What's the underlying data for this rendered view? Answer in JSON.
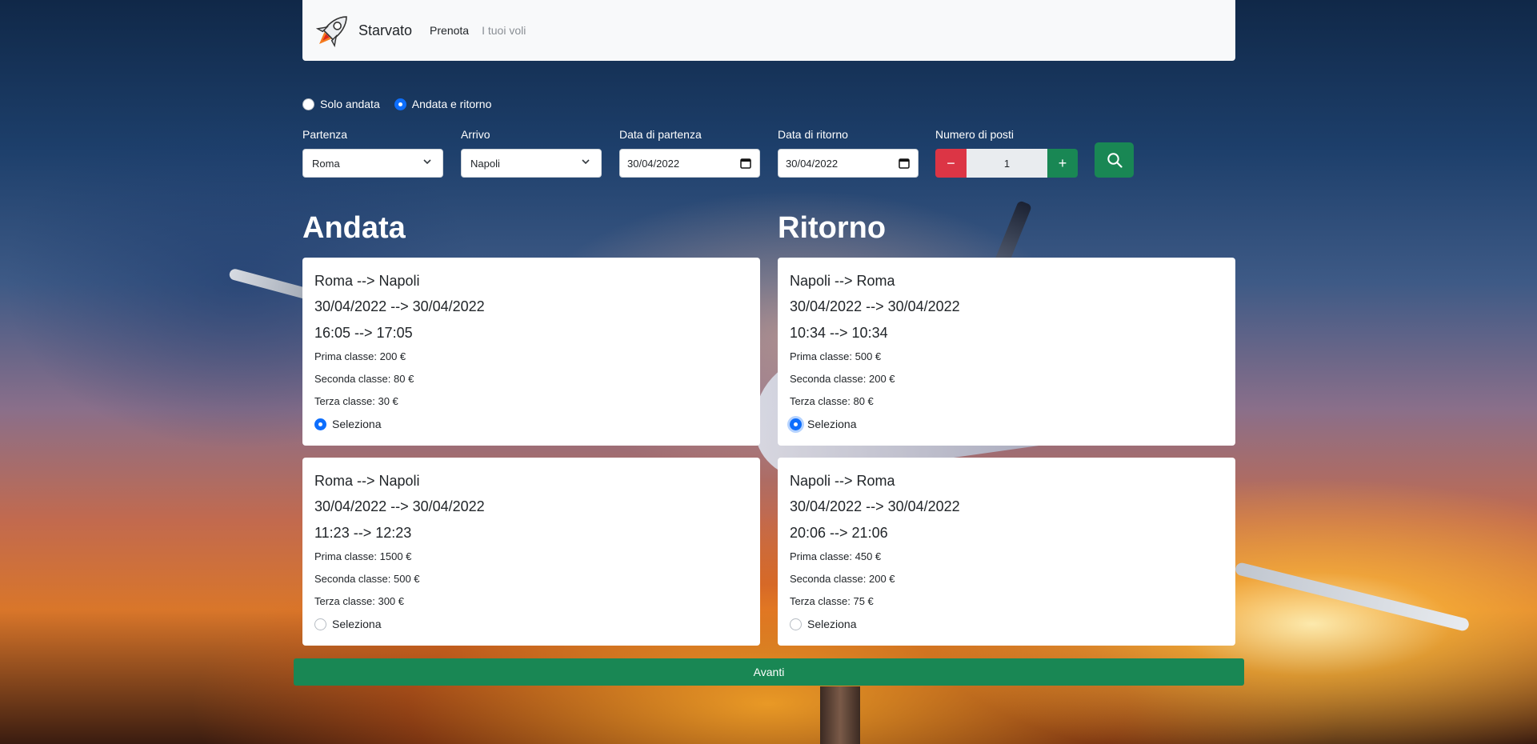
{
  "navbar": {
    "brand_name": "Starvato",
    "links": [
      {
        "label": "Prenota",
        "active": true
      },
      {
        "label": "I tuoi voli",
        "active": false
      }
    ]
  },
  "trip_type": {
    "options": [
      {
        "label": "Solo andata",
        "checked": false
      },
      {
        "label": "Andata e ritorno",
        "checked": true
      }
    ]
  },
  "search": {
    "departure_label": "Partenza",
    "departure_value": "Roma",
    "arrival_label": "Arrivo",
    "arrival_value": "Napoli",
    "departure_date_label": "Data di partenza",
    "departure_date_value": "30/04/2022",
    "return_date_label": "Data di ritorno",
    "return_date_value": "30/04/2022",
    "seats_label": "Numero di posti",
    "seats_value": "1",
    "minus_symbol": "−",
    "plus_symbol": "+"
  },
  "outbound": {
    "title": "Andata",
    "flights": [
      {
        "route": "Roma --> Napoli",
        "dates": "30/04/2022 --> 30/04/2022",
        "times": "16:05 --> 17:05",
        "first_class": "Prima classe: 200 €",
        "second_class": "Seconda classe: 80 €",
        "third_class": "Terza classe: 30 €",
        "select_label": "Seleziona",
        "selected": true
      },
      {
        "route": "Roma --> Napoli",
        "dates": "30/04/2022 --> 30/04/2022",
        "times": "11:23 --> 12:23",
        "first_class": "Prima classe: 1500 €",
        "second_class": "Seconda classe: 500 €",
        "third_class": "Terza classe: 300 €",
        "select_label": "Seleziona",
        "selected": false
      }
    ]
  },
  "return": {
    "title": "Ritorno",
    "flights": [
      {
        "route": "Napoli --> Roma",
        "dates": "30/04/2022 --> 30/04/2022",
        "times": "10:34 --> 10:34",
        "first_class": "Prima classe: 500 €",
        "second_class": "Seconda classe: 200 €",
        "third_class": "Terza classe: 80 €",
        "select_label": "Seleziona",
        "selected": true
      },
      {
        "route": "Napoli --> Roma",
        "dates": "30/04/2022 --> 30/04/2022",
        "times": "20:06 --> 21:06",
        "first_class": "Prima classe: 450 €",
        "second_class": "Seconda classe: 200 €",
        "third_class": "Terza classe: 75 €",
        "select_label": "Seleziona",
        "selected": false
      }
    ]
  },
  "next_button": "Avanti",
  "colors": {
    "primary": "#0d6efd",
    "success": "#198754",
    "danger": "#dc3545",
    "navbar_bg": "#f8f9fa"
  },
  "icons": [
    "rocket-logo-icon",
    "chevron-down-icon",
    "calendar-icon",
    "search-icon"
  ]
}
